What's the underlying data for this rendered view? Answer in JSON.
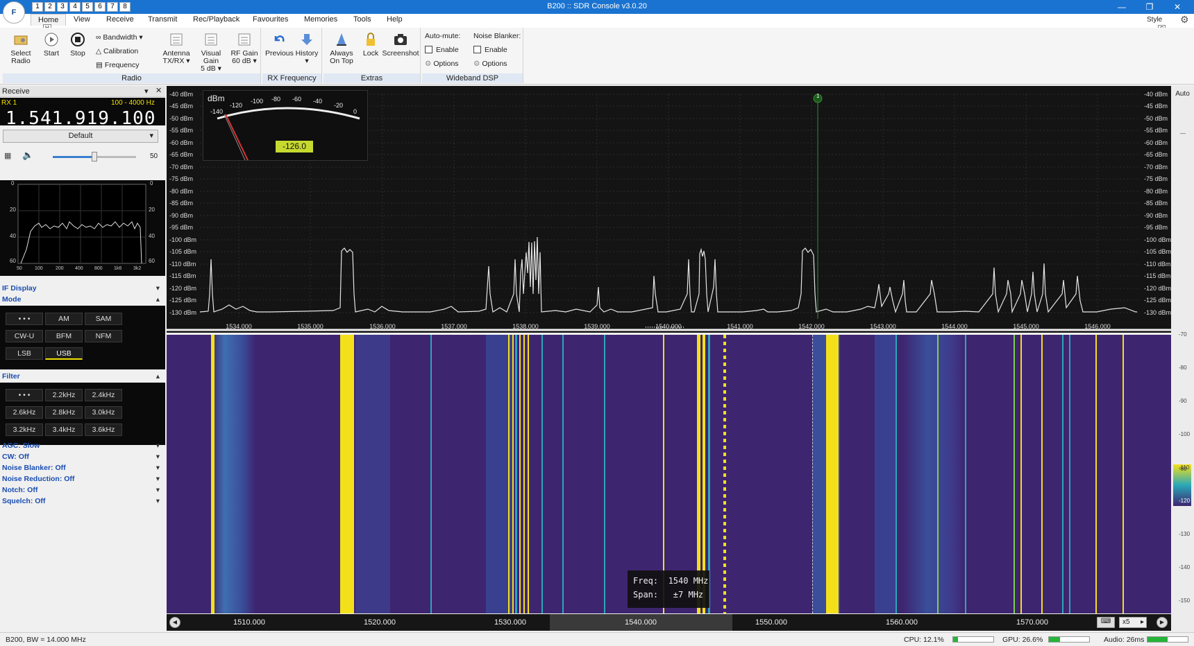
{
  "window": {
    "title": "B200 :: SDR Console v3.0.20",
    "app_button": "F"
  },
  "quick_access": [
    "1",
    "2",
    "3",
    "4",
    "5",
    "6",
    "7",
    "8"
  ],
  "menu": {
    "tabs": [
      "Home",
      "View",
      "Receive",
      "Transmit",
      "Rec/Playback",
      "Favourites",
      "Memories",
      "Tools",
      "Help"
    ],
    "active": "Home",
    "hotkey": "H",
    "style_label": "Style",
    "style_hotkey": "S"
  },
  "ribbon": {
    "radio": {
      "label": "Radio",
      "select_radio": "Select Radio",
      "start": "Start",
      "stop": "Stop",
      "bandwidth": "Bandwidth",
      "calibration": "Calibration",
      "frequency": "Frequency",
      "antenna": "Antenna",
      "antenna_val": "TX/RX",
      "visual_gain": "Visual Gain",
      "visual_gain_val": "5 dB",
      "rf_gain": "RF Gain",
      "rf_gain_val": "60 dB"
    },
    "rx_frequency": {
      "label": "RX Frequency",
      "previous": "Previous",
      "history": "History"
    },
    "extras": {
      "label": "Extras",
      "always_on_top": "Always On Top",
      "lock": "Lock",
      "screenshot": "Screenshot"
    },
    "wideband_dsp": {
      "label": "Wideband DSP",
      "automute_title": "Auto-mute:",
      "automute_enable": "Enable",
      "automute_options": "Options",
      "nb_title": "Noise Blanker:",
      "nb_enable": "Enable",
      "nb_options": "Options"
    }
  },
  "receive_panel": {
    "header": "Receive",
    "rx_label": "RX 1",
    "range": "100 - 4000 Hz",
    "frequency": "1.541.919.100",
    "profile": "Default",
    "volume": "50",
    "volume_level": 0.5,
    "audio_y_ticks": [
      "0",
      "20",
      "40",
      "60"
    ],
    "audio_x_ticks": [
      "50",
      "100",
      "200",
      "400",
      "800",
      "1k6",
      "3k2"
    ],
    "if_display": "IF Display",
    "mode": "Mode",
    "mode_buttons": [
      "• • •",
      "AM",
      "SAM",
      "CW-U",
      "BFM",
      "NFM",
      "LSB",
      "USB"
    ],
    "mode_selected": "USB",
    "filter": "Filter",
    "filter_buttons": [
      "• • •",
      "2.2kHz",
      "2.4kHz",
      "2.6kHz",
      "2.8kHz",
      "3.0kHz",
      "3.2kHz",
      "3.4kHz",
      "3.6kHz"
    ],
    "settings": [
      "AGC: Slow",
      "CW: Off",
      "Noise Blanker: Off",
      "Noise Reduction: Off",
      "Notch: Off",
      "Squelch: Off"
    ]
  },
  "spectrum": {
    "dbm_labels": [
      "-40 dBm",
      "-45 dBm",
      "-50 dBm",
      "-55 dBm",
      "-60 dBm",
      "-65 dBm",
      "-70 dBm",
      "-75 dBm",
      "-80 dBm",
      "-85 dBm",
      "-90 dBm",
      "-95 dBm",
      "-100 dBm",
      "-105 dBm",
      "-110 dBm",
      "-115 dBm",
      "-120 dBm",
      "-125 dBm",
      "-130 dBm"
    ],
    "freq_labels": [
      "1534.000",
      "1535.000",
      "1536.000",
      "1537.000",
      "1538.000",
      "1539.000",
      "1540.000",
      "1541.000",
      "1542.000",
      "1543.000",
      "1544.000",
      "1545.000",
      "1546.000"
    ],
    "meter_unit": "dBm",
    "meter_scale": [
      "-140",
      "-120",
      "-100",
      "-80",
      "-60",
      "-40",
      "-20",
      "0"
    ],
    "meter_value": "-126.0",
    "marker": "1",
    "auto_label": "Auto"
  },
  "waterfall": {
    "tooltip_freq": "Freq:  1540 MHz",
    "tooltip_span": "Span:   ±7 MHz",
    "scale_labels": [
      "1510.000",
      "1520.000",
      "1530.000",
      "1540.000",
      "1550.000",
      "1560.000",
      "1570.000"
    ],
    "zoom": "x5",
    "right_ticks": [
      "-70",
      "-80",
      "-90",
      "-100",
      "-110",
      "-120",
      "-130",
      "-140",
      "-150"
    ],
    "cbar_labels": [
      "-80",
      "-120"
    ]
  },
  "status": {
    "left": "B200, BW = 14.000 MHz",
    "cpu": "CPU: 12.1%",
    "cpu_level": 0.12,
    "gpu": "GPU: 26.6%",
    "gpu_level": 0.27,
    "audio": "Audio: 26ms",
    "audio_level": 0.5
  },
  "colors": {
    "accent": "#1a73d0",
    "waterfall_bg": "#3e2570",
    "signal": "#f4e01a",
    "green": "#26b43a"
  }
}
